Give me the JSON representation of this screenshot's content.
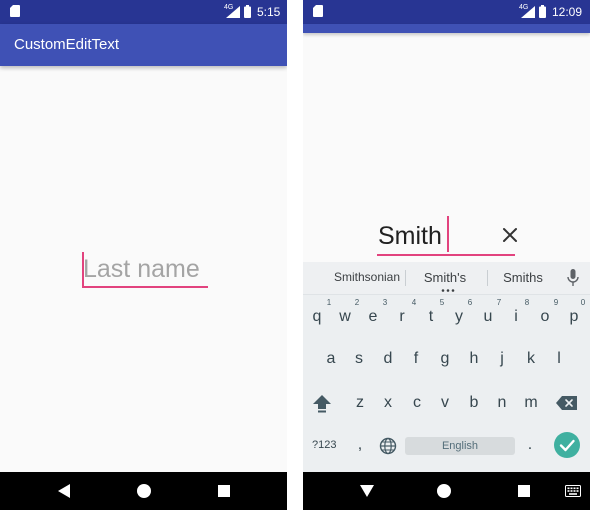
{
  "left_screen": {
    "status_bar": {
      "network": "4G",
      "time": "5:15"
    },
    "app_title": "CustomEditText",
    "edit_text": {
      "placeholder": "Last name"
    }
  },
  "right_screen": {
    "status_bar": {
      "network": "4G",
      "time": "12:09"
    },
    "edit_text": {
      "value": "Smith"
    },
    "keyboard": {
      "suggestions": [
        "Smithsonian",
        "Smith's",
        "Smiths"
      ],
      "row1": [
        {
          "key": "q",
          "hint": "1"
        },
        {
          "key": "w",
          "hint": "2"
        },
        {
          "key": "e",
          "hint": "3"
        },
        {
          "key": "r",
          "hint": "4"
        },
        {
          "key": "t",
          "hint": "5"
        },
        {
          "key": "y",
          "hint": "6"
        },
        {
          "key": "u",
          "hint": "7"
        },
        {
          "key": "i",
          "hint": "8"
        },
        {
          "key": "o",
          "hint": "9"
        },
        {
          "key": "p",
          "hint": "0"
        }
      ],
      "row2": [
        "a",
        "s",
        "d",
        "f",
        "g",
        "h",
        "j",
        "k",
        "l"
      ],
      "row3": [
        "z",
        "x",
        "c",
        "v",
        "b",
        "n",
        "m"
      ],
      "symbols_label": "?123",
      "comma": ",",
      "space_label": "English",
      "period": "."
    }
  },
  "colors": {
    "status_bar": "#283593",
    "app_bar": "#3f51b5",
    "accent": "#e2437e",
    "keyboard_bg": "#eceff1",
    "done_key": "#3fb0a0"
  },
  "icons": [
    "sd-card-icon",
    "signal-icon",
    "battery-icon",
    "clear-icon",
    "mic-icon",
    "shift-icon",
    "backspace-icon",
    "globe-icon",
    "checkmark-icon",
    "back-icon",
    "home-icon",
    "recents-icon",
    "hide-keyboard-icon",
    "keyboard-switcher-icon"
  ]
}
